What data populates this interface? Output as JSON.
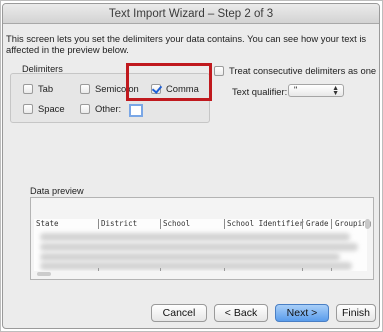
{
  "window": {
    "title": "Text Import Wizard – Step 2 of 3"
  },
  "instructions": "This screen lets you set the delimiters your data contains.  You can see how your text is affected in the preview below.",
  "delimiters": {
    "label": "Delimiters",
    "tab": {
      "label": "Tab",
      "checked": false
    },
    "semicolon": {
      "label": "Semicolon",
      "checked": false
    },
    "comma": {
      "label": "Comma",
      "checked": true
    },
    "space": {
      "label": "Space",
      "checked": false
    },
    "other": {
      "label": "Other:",
      "checked": false,
      "value": ""
    }
  },
  "consecutive": {
    "label": "Treat consecutive delimiters as one",
    "checked": false
  },
  "qualifier": {
    "label": "Text qualifier:",
    "value": "\""
  },
  "preview": {
    "label": "Data preview",
    "columns": [
      "State",
      "District",
      "School",
      "School Identifier",
      "Grade",
      "Grouping"
    ]
  },
  "buttons": {
    "cancel": "Cancel",
    "back": "< Back",
    "next": "Next >",
    "finish": "Finish"
  },
  "colors": {
    "highlight": "#c0191e",
    "accent": "#5a9cec",
    "window_bg": "#ececec"
  }
}
